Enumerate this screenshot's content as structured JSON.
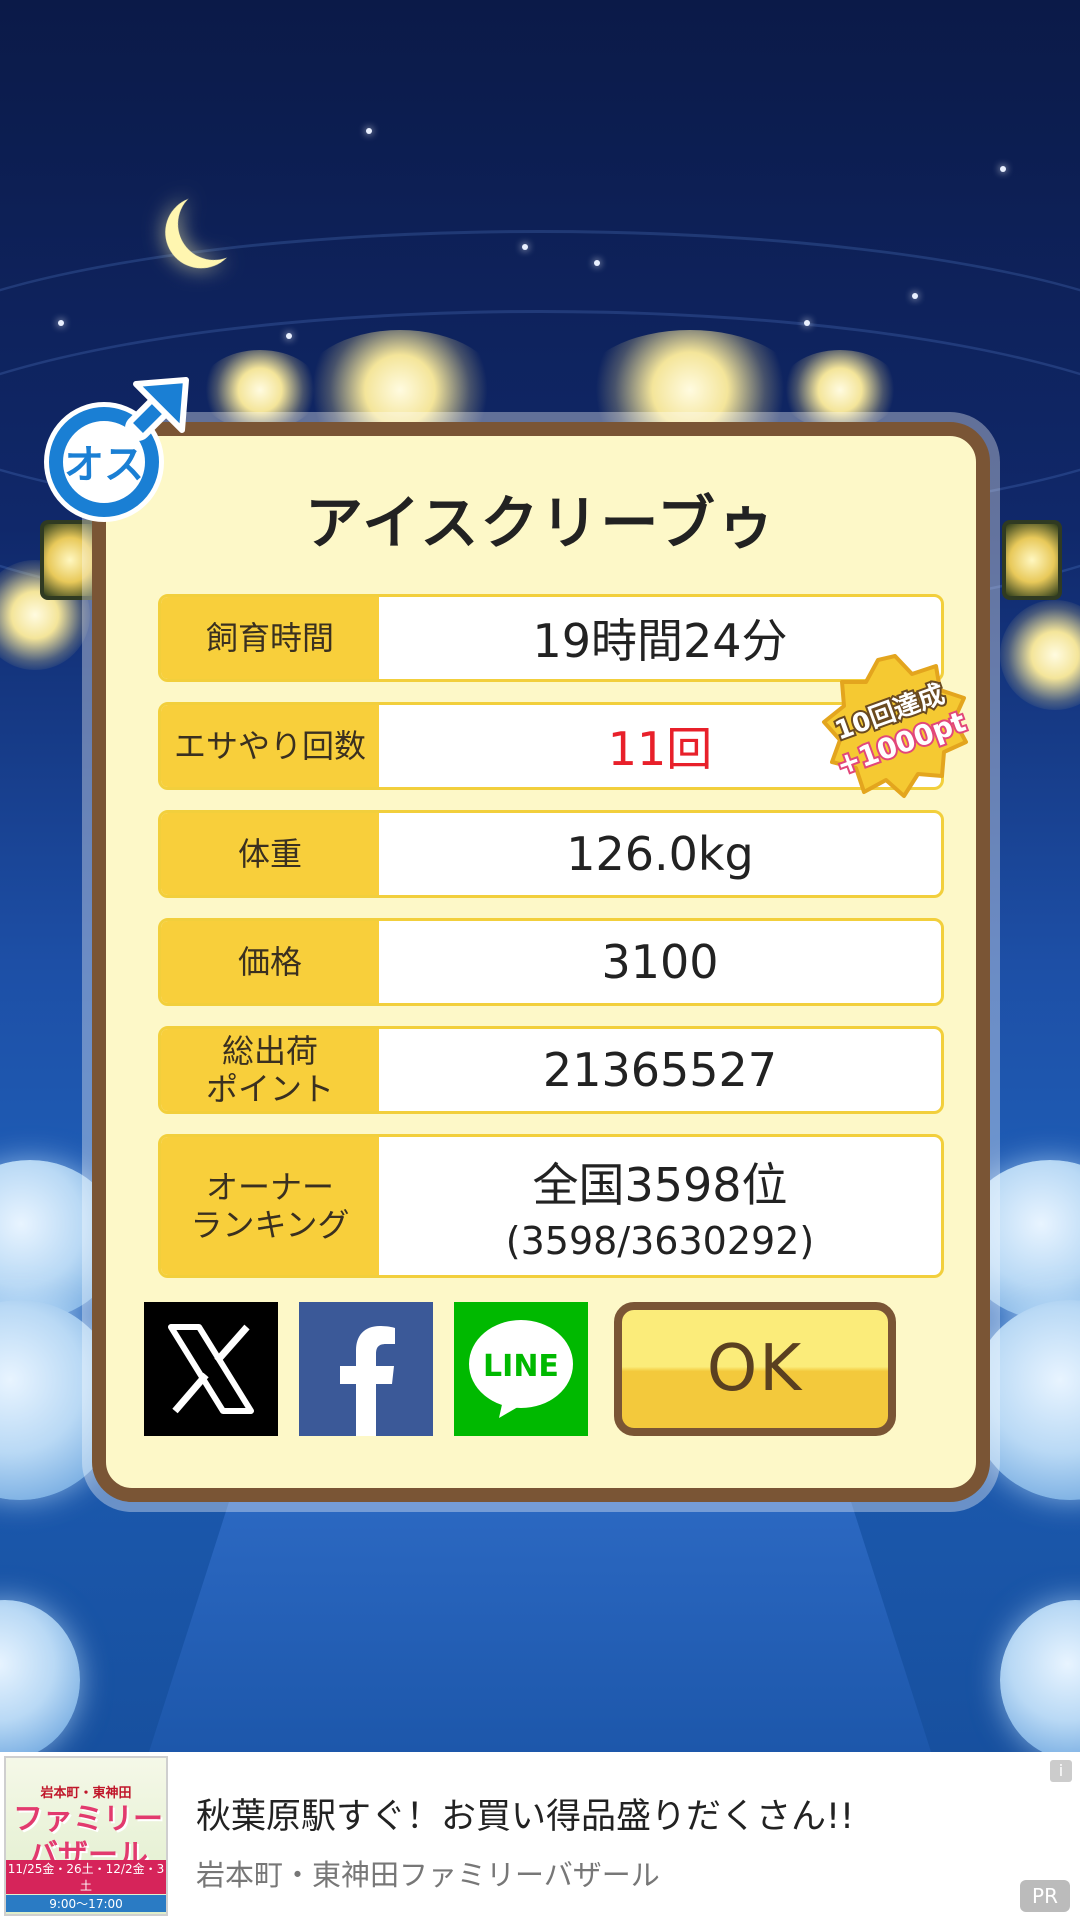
{
  "character": {
    "name": "アイスクリーブゥ",
    "sex_badge": "オス"
  },
  "stats": [
    {
      "label": "飼育時間",
      "value": "19時間24分"
    },
    {
      "label": "エサやり回数",
      "value": "11回",
      "value_color": "#e8202a"
    },
    {
      "label": "体重",
      "value": "126.0kg"
    },
    {
      "label": "価格",
      "value": "3100"
    },
    {
      "label_line1": "総出荷",
      "label_line2": "ポイント",
      "value": "21365527"
    },
    {
      "label_line1": "オーナー",
      "label_line2": "ランキング",
      "value": "全国3598位",
      "value_sub": "(3598/3630292)"
    }
  ],
  "achievement_badge": {
    "line1": "10回達成",
    "line2": "+1000pt"
  },
  "share_buttons": [
    {
      "name": "x-share",
      "icon": "x-logo-icon"
    },
    {
      "name": "facebook-share",
      "icon": "facebook-logo-icon"
    },
    {
      "name": "line-share",
      "icon": "line-logo-icon",
      "text": "LINE"
    }
  ],
  "ok_button": {
    "label": "OK"
  },
  "ad": {
    "image_text_top": "岩本町・東神田",
    "image_text_main_1": "ファミリー",
    "image_text_main_2": "バザール",
    "image_dates": "11/25金・26土・12/2金・3土",
    "image_hours": "9:00〜17:00",
    "title": "秋葉原駅すぐ！お買い得品盛りだくさん!!",
    "advertiser": "岩本町・東神田ファミリーバザール",
    "info_icon": "i",
    "pr_label": "PR"
  },
  "colors": {
    "panel_bg": "#fdf8c8",
    "panel_border": "#7a5535",
    "label_bg": "#f8cf3b",
    "highlight_red": "#e8202a",
    "male_blue": "#1a7fd4",
    "facebook_blue": "#3b5998",
    "line_green": "#00b900"
  }
}
